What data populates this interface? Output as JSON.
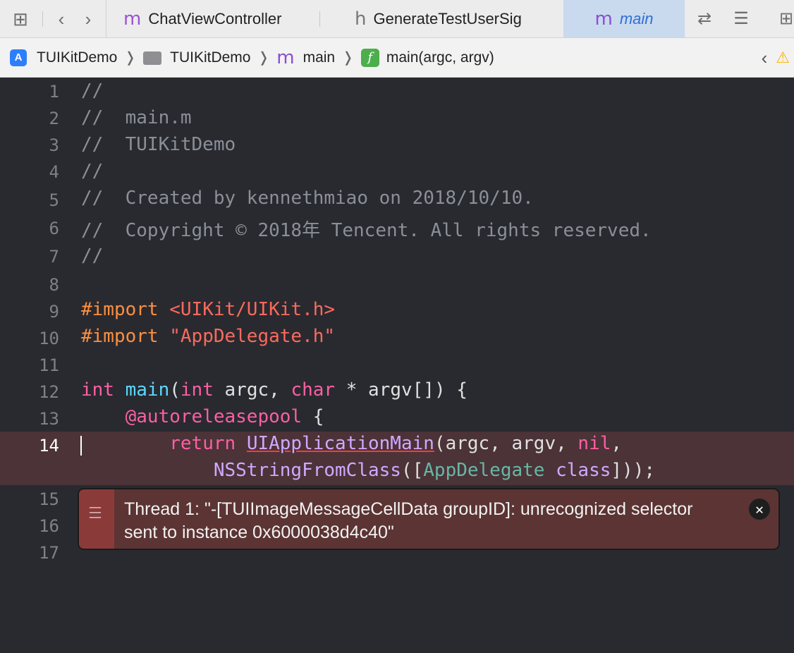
{
  "tabbar": {
    "tabs": [
      {
        "icon": "m",
        "label": "ChatViewController"
      },
      {
        "icon": "h",
        "label": "GenerateTestUserSig"
      },
      {
        "icon": "m",
        "label": "main",
        "active": true
      }
    ]
  },
  "jumpbar": {
    "crumbs": [
      "TUIKitDemo",
      "TUIKitDemo",
      "main",
      "main(argc, argv)"
    ]
  },
  "editor": {
    "line_numbers": [
      "1",
      "2",
      "3",
      "4",
      "5",
      "6",
      "7",
      "8",
      "9",
      "10",
      "11",
      "12",
      "13",
      "14",
      "15",
      "16",
      "17"
    ],
    "current_line": "14",
    "comment_lines": [
      "//",
      "//  main.m",
      "//  TUIKitDemo",
      "//",
      "//  Created by kennethmiao on 2018/10/10.",
      "//  Copyright © 2018年 Tencent. All rights reserved.",
      "//"
    ],
    "import1": {
      "directive": "#import",
      "path": "<UIKit/UIKit.h>"
    },
    "import2": {
      "directive": "#import",
      "path": "\"AppDelegate.h\""
    },
    "line12": {
      "kw1": "int",
      "fn": "main",
      "p1": "(",
      "kw2": "int",
      "p2": " argc, ",
      "kw3": "char",
      "p3": " * argv[]) {"
    },
    "line13": {
      "dir": "@autoreleasepool",
      "rest": " {"
    },
    "line14": {
      "kw": "return",
      "fn": "UIApplicationMain",
      "p1": "(argc, argv, ",
      "nil": "nil",
      "p2": ","
    },
    "line14b": {
      "fn": "NSStringFromClass",
      "p1": "([",
      "cls": "AppDelegate",
      "kw": "class",
      "p2": "]));"
    }
  },
  "error_banner": {
    "message": "Thread 1: \"-[TUIImageMessageCellData groupID]: unrecognized selector sent to instance 0x6000038d4c40\"",
    "close_glyph": "✕"
  },
  "colors": {
    "editor_bg": "#292a30",
    "error_line_bg": "#4b3338",
    "banner_bg": "#5c3434"
  }
}
